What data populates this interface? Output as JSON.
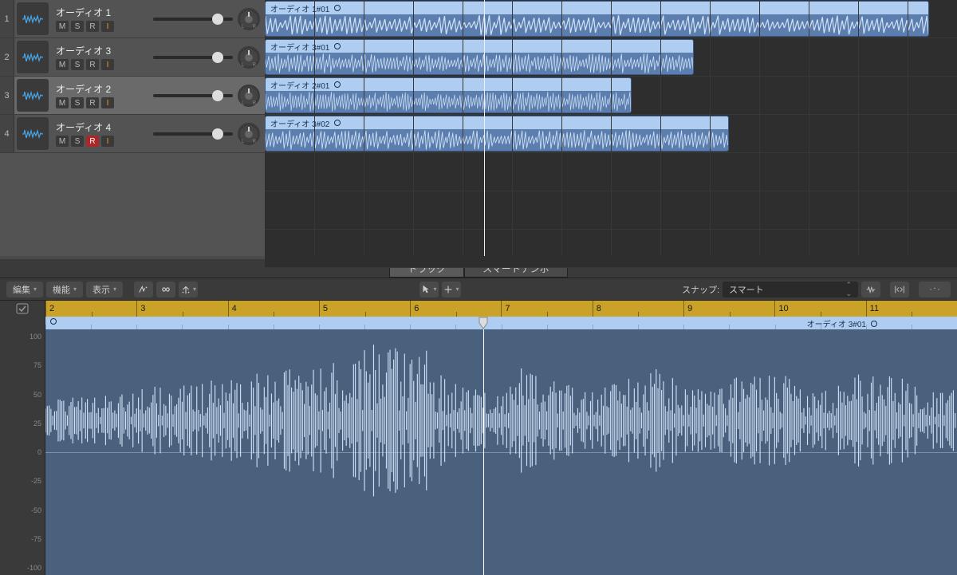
{
  "tracks": [
    {
      "num": "1",
      "name": "オーディオ 1",
      "m": "M",
      "s": "S",
      "r": "R",
      "i": "I",
      "r_armed": false,
      "selected": false
    },
    {
      "num": "2",
      "name": "オーディオ 3",
      "m": "M",
      "s": "S",
      "r": "R",
      "i": "I",
      "r_armed": false,
      "selected": false
    },
    {
      "num": "3",
      "name": "オーディオ 2",
      "m": "M",
      "s": "S",
      "r": "R",
      "i": "I",
      "r_armed": false,
      "selected": true
    },
    {
      "num": "4",
      "name": "オーディオ 4",
      "m": "M",
      "s": "S",
      "r": "R",
      "i": "I",
      "r_armed": true,
      "selected": false
    }
  ],
  "regions": [
    {
      "name": "オーディオ 1#01",
      "left_pct": 0,
      "width_pct": 96
    },
    {
      "name": "オーディオ 3#01",
      "left_pct": 0,
      "width_pct": 62
    },
    {
      "name": "オーディオ 2#01",
      "left_pct": 0,
      "width_pct": 53
    },
    {
      "name": "オーディオ 3#02",
      "left_pct": 0,
      "width_pct": 67
    }
  ],
  "editor": {
    "tabs": {
      "track": "トラック",
      "smart_tempo": "スマートテンポ"
    },
    "menus": {
      "edit": "編集",
      "func": "機能",
      "view": "表示"
    },
    "snap_label": "スナップ:",
    "snap_value": "スマート",
    "ruler": [
      "2",
      "3",
      "4",
      "5",
      "6",
      "7",
      "8",
      "9",
      "10",
      "11"
    ],
    "clip_name": "オーディオ 3#01",
    "amp_scale": [
      "100",
      "75",
      "50",
      "25",
      "0",
      "-25",
      "-50",
      "-75",
      "-100"
    ]
  }
}
